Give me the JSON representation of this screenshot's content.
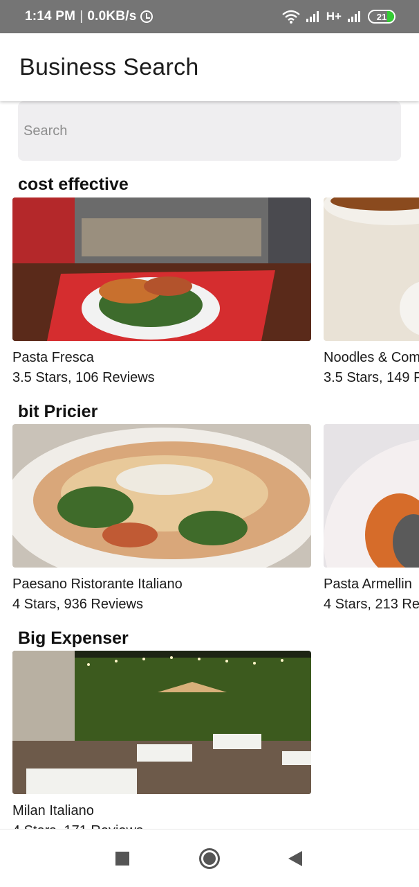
{
  "status_bar": {
    "time": "1:14 PM",
    "speed": "0.0KB/s",
    "network": "H+",
    "battery": "21",
    "alarm_icon": "alarm-icon",
    "wifi_icon": "wifi-icon",
    "signal_icon": "signal-icon",
    "battery_icon": "battery-icon"
  },
  "app_bar": {
    "title": "Business Search"
  },
  "search": {
    "placeholder": "Search",
    "value": ""
  },
  "sections": [
    {
      "title": "cost effective",
      "cards": [
        {
          "name": "Pasta Fresca",
          "meta": "3.5 Stars, 106 Reviews"
        },
        {
          "name": "Noodles & Com",
          "meta": "3.5 Stars, 149 F"
        }
      ]
    },
    {
      "title": "bit Pricier",
      "cards": [
        {
          "name": "Paesano Ristorante Italiano",
          "meta": "4 Stars, 936 Reviews"
        },
        {
          "name": "Pasta Armellin",
          "meta": "4 Stars, 213 Re"
        }
      ]
    },
    {
      "title": "Big Expenser",
      "cards": [
        {
          "name": "Milan Italiano",
          "meta": "4 Stars, 171 Reviews"
        }
      ]
    }
  ],
  "nav_bar": {
    "recents_icon": "recents-square-icon",
    "home_icon": "home-circle-icon",
    "back_icon": "back-triangle-icon"
  },
  "colors": {
    "status_bar": "#757575",
    "search_bg": "#efeef0",
    "battery_fill": "#33cc33"
  }
}
